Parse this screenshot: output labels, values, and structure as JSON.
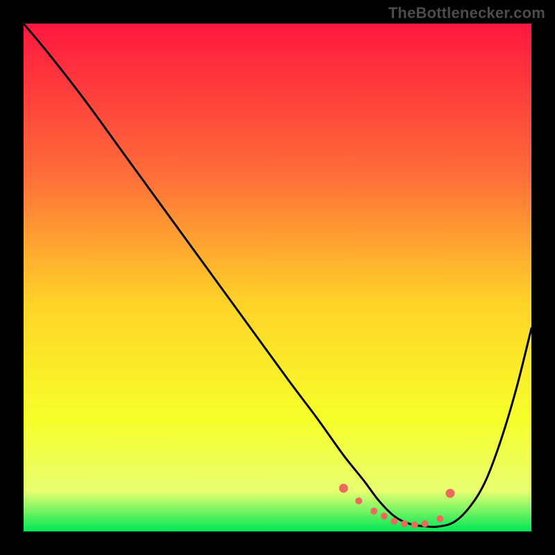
{
  "attribution": "TheBottlenecker.com",
  "colors": {
    "background": "#000000",
    "gradient_top": "#ff173f",
    "gradient_upper_mid": "#ff6e3a",
    "gradient_mid": "#ffd328",
    "gradient_lower_mid": "#f6ff2a",
    "gradient_low": "#e8ff70",
    "gradient_bottom": "#00e756",
    "curve": "#000000",
    "marker_stroke": "#ec6a5c",
    "marker_fill": "#ec6a5c"
  },
  "chart_data": {
    "type": "line",
    "title": "",
    "xlabel": "",
    "ylabel": "",
    "xlim": [
      0,
      100
    ],
    "ylim": [
      0,
      100
    ],
    "grid": false,
    "series": [
      {
        "name": "bottleneck-curve",
        "x": [
          0,
          5,
          12,
          20,
          28,
          36,
          44,
          52,
          58,
          63,
          67,
          70,
          73,
          76,
          79,
          82,
          85,
          88,
          91,
          94,
          97,
          100
        ],
        "y": [
          100,
          94,
          85,
          74,
          63,
          52,
          41,
          30,
          22,
          15,
          10,
          6,
          3,
          1.5,
          1,
          1,
          2,
          5,
          10,
          18,
          28,
          40
        ]
      }
    ],
    "markers": {
      "name": "highlight-range",
      "x": [
        63,
        66,
        69,
        71,
        73,
        75,
        77,
        79,
        82,
        84
      ],
      "y": [
        8.5,
        6.0,
        4.0,
        3.0,
        2.0,
        1.5,
        1.3,
        1.5,
        2.5,
        7.5
      ]
    }
  }
}
